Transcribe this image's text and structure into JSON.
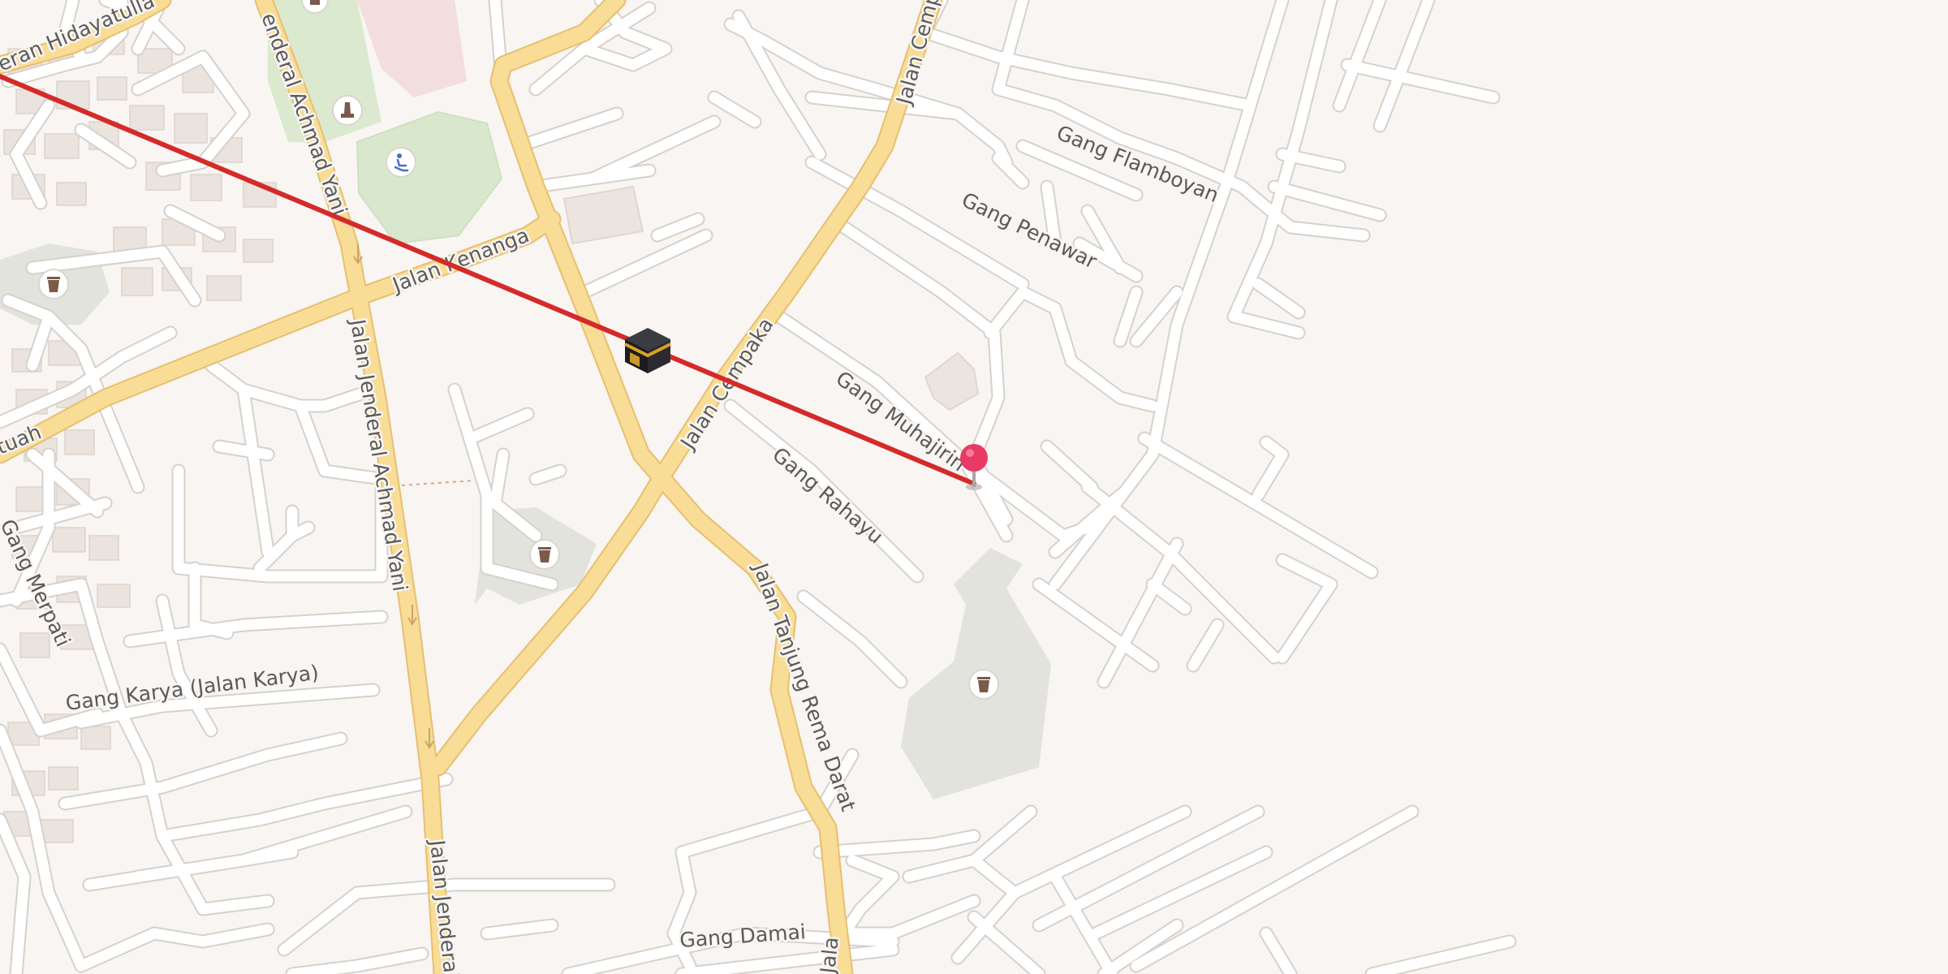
{
  "colors": {
    "background": "#f8f5f2",
    "primary_road": "#f9dc96",
    "minor_road": "#ffffff",
    "route_line": "#d42a2a",
    "pin": "#e83a64",
    "park": "#dbe9cf",
    "cemetery": "#e1e3dc",
    "building": "#ece4df"
  },
  "labels": {
    "pangeran_hidayatullah": "eran Hidayatulla",
    "jenderal_achmad_yani_top": "enderal Achmad Yani",
    "jalan_kenanga": "Jalan Kenanga",
    "jalan_jenderal_achmad_yani_mid": "Jalan Jenderal Achmad Yani",
    "jalan_jenderal_bottom": "Jalan Jenderal",
    "jalan_cempaka_mid": "Jalan Cempaka",
    "jalan_cempaka_top": "Jalan Cemp",
    "gang_flamboyan": "Gang Flamboyan",
    "gang_penawar": "Gang Penawar",
    "gang_muhajirin": "Gang Muhajirin",
    "gang_rahayu": "Gang Rahayu",
    "jalan_tanjung_rema_darat": "Jalan Tanjung Rema Darat",
    "gang_merpati": "Gang Merpati",
    "gang_karya": "Gang Karya (Jalan Karya)",
    "gang_damai": "Gang Damai",
    "tuah": "tuah",
    "jala_bottom": "Jala"
  },
  "markers": {
    "kaaba": {
      "icon": "kaaba-icon",
      "meaning": "qibla direction"
    },
    "pin": {
      "icon": "location-pin-icon"
    }
  },
  "poi_icons": [
    "cemetery-icon",
    "monument-icon",
    "sports-centre-icon"
  ]
}
